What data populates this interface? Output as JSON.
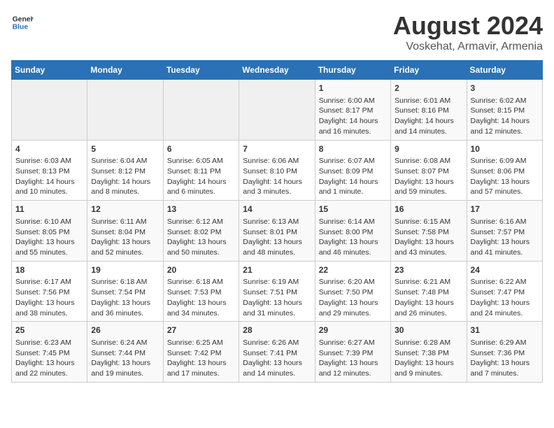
{
  "header": {
    "logo_general": "General",
    "logo_blue": "Blue",
    "title": "August 2024",
    "subtitle": "Voskehat, Armavir, Armenia"
  },
  "days_of_week": [
    "Sunday",
    "Monday",
    "Tuesday",
    "Wednesday",
    "Thursday",
    "Friday",
    "Saturday"
  ],
  "weeks": [
    [
      {
        "day": "",
        "content": ""
      },
      {
        "day": "",
        "content": ""
      },
      {
        "day": "",
        "content": ""
      },
      {
        "day": "",
        "content": ""
      },
      {
        "day": "1",
        "content": "Sunrise: 6:00 AM\nSunset: 8:17 PM\nDaylight: 14 hours\nand 16 minutes."
      },
      {
        "day": "2",
        "content": "Sunrise: 6:01 AM\nSunset: 8:16 PM\nDaylight: 14 hours\nand 14 minutes."
      },
      {
        "day": "3",
        "content": "Sunrise: 6:02 AM\nSunset: 8:15 PM\nDaylight: 14 hours\nand 12 minutes."
      }
    ],
    [
      {
        "day": "4",
        "content": "Sunrise: 6:03 AM\nSunset: 8:13 PM\nDaylight: 14 hours\nand 10 minutes."
      },
      {
        "day": "5",
        "content": "Sunrise: 6:04 AM\nSunset: 8:12 PM\nDaylight: 14 hours\nand 8 minutes."
      },
      {
        "day": "6",
        "content": "Sunrise: 6:05 AM\nSunset: 8:11 PM\nDaylight: 14 hours\nand 6 minutes."
      },
      {
        "day": "7",
        "content": "Sunrise: 6:06 AM\nSunset: 8:10 PM\nDaylight: 14 hours\nand 3 minutes."
      },
      {
        "day": "8",
        "content": "Sunrise: 6:07 AM\nSunset: 8:09 PM\nDaylight: 14 hours\nand 1 minute."
      },
      {
        "day": "9",
        "content": "Sunrise: 6:08 AM\nSunset: 8:07 PM\nDaylight: 13 hours\nand 59 minutes."
      },
      {
        "day": "10",
        "content": "Sunrise: 6:09 AM\nSunset: 8:06 PM\nDaylight: 13 hours\nand 57 minutes."
      }
    ],
    [
      {
        "day": "11",
        "content": "Sunrise: 6:10 AM\nSunset: 8:05 PM\nDaylight: 13 hours\nand 55 minutes."
      },
      {
        "day": "12",
        "content": "Sunrise: 6:11 AM\nSunset: 8:04 PM\nDaylight: 13 hours\nand 52 minutes."
      },
      {
        "day": "13",
        "content": "Sunrise: 6:12 AM\nSunset: 8:02 PM\nDaylight: 13 hours\nand 50 minutes."
      },
      {
        "day": "14",
        "content": "Sunrise: 6:13 AM\nSunset: 8:01 PM\nDaylight: 13 hours\nand 48 minutes."
      },
      {
        "day": "15",
        "content": "Sunrise: 6:14 AM\nSunset: 8:00 PM\nDaylight: 13 hours\nand 46 minutes."
      },
      {
        "day": "16",
        "content": "Sunrise: 6:15 AM\nSunset: 7:58 PM\nDaylight: 13 hours\nand 43 minutes."
      },
      {
        "day": "17",
        "content": "Sunrise: 6:16 AM\nSunset: 7:57 PM\nDaylight: 13 hours\nand 41 minutes."
      }
    ],
    [
      {
        "day": "18",
        "content": "Sunrise: 6:17 AM\nSunset: 7:56 PM\nDaylight: 13 hours\nand 38 minutes."
      },
      {
        "day": "19",
        "content": "Sunrise: 6:18 AM\nSunset: 7:54 PM\nDaylight: 13 hours\nand 36 minutes."
      },
      {
        "day": "20",
        "content": "Sunrise: 6:18 AM\nSunset: 7:53 PM\nDaylight: 13 hours\nand 34 minutes."
      },
      {
        "day": "21",
        "content": "Sunrise: 6:19 AM\nSunset: 7:51 PM\nDaylight: 13 hours\nand 31 minutes."
      },
      {
        "day": "22",
        "content": "Sunrise: 6:20 AM\nSunset: 7:50 PM\nDaylight: 13 hours\nand 29 minutes."
      },
      {
        "day": "23",
        "content": "Sunrise: 6:21 AM\nSunset: 7:48 PM\nDaylight: 13 hours\nand 26 minutes."
      },
      {
        "day": "24",
        "content": "Sunrise: 6:22 AM\nSunset: 7:47 PM\nDaylight: 13 hours\nand 24 minutes."
      }
    ],
    [
      {
        "day": "25",
        "content": "Sunrise: 6:23 AM\nSunset: 7:45 PM\nDaylight: 13 hours\nand 22 minutes."
      },
      {
        "day": "26",
        "content": "Sunrise: 6:24 AM\nSunset: 7:44 PM\nDaylight: 13 hours\nand 19 minutes."
      },
      {
        "day": "27",
        "content": "Sunrise: 6:25 AM\nSunset: 7:42 PM\nDaylight: 13 hours\nand 17 minutes."
      },
      {
        "day": "28",
        "content": "Sunrise: 6:26 AM\nSunset: 7:41 PM\nDaylight: 13 hours\nand 14 minutes."
      },
      {
        "day": "29",
        "content": "Sunrise: 6:27 AM\nSunset: 7:39 PM\nDaylight: 13 hours\nand 12 minutes."
      },
      {
        "day": "30",
        "content": "Sunrise: 6:28 AM\nSunset: 7:38 PM\nDaylight: 13 hours\nand 9 minutes."
      },
      {
        "day": "31",
        "content": "Sunrise: 6:29 AM\nSunset: 7:36 PM\nDaylight: 13 hours\nand 7 minutes."
      }
    ]
  ]
}
